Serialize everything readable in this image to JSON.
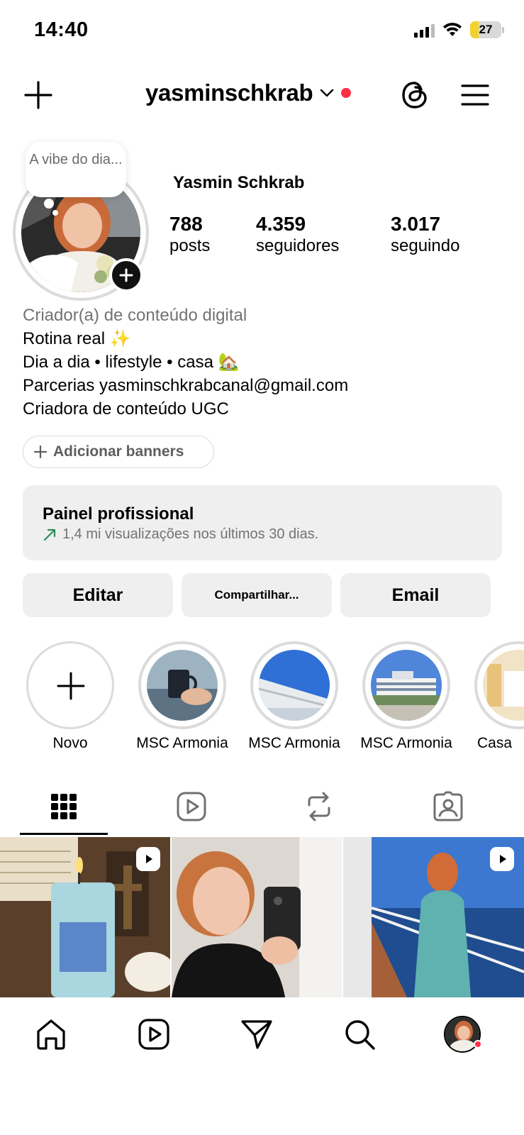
{
  "status_bar": {
    "time": "14:40",
    "battery": "27",
    "battery_level_percent": 27,
    "battery_color": "#f4d22c"
  },
  "header": {
    "username": "yasminschkrab",
    "icons": [
      "plus-icon",
      "chevron-down-icon",
      "threads-icon",
      "menu-icon"
    ],
    "notification_dot_color": "#ff2d45"
  },
  "profile": {
    "note": "A vibe do dia...",
    "display_name": "Yasmin Schkrab",
    "stats": [
      {
        "number": "788",
        "label": "posts"
      },
      {
        "number": "4.359",
        "label": "seguidores"
      },
      {
        "number": "3.017",
        "label": "seguindo"
      }
    ],
    "bio": {
      "category": "Criador(a) de conteúdo digital",
      "lines": [
        "Rotina real ✨",
        "Dia a dia • lifestyle • casa 🏡",
        "Parcerias yasminschkrabcanal@gmail.com",
        "Criadora de conteúdo UGC"
      ]
    },
    "banners_button": "Adicionar banners"
  },
  "pro_panel": {
    "title": "Painel profissional",
    "subtitle": "1,4 mi visualizações nos últimos 30 dias.",
    "trend_color": "#2e8b57"
  },
  "actions": {
    "edit": "Editar",
    "share": "Compartilhar...",
    "email": "Email"
  },
  "highlights": [
    {
      "label": "Novo"
    },
    {
      "label": "MSC Armonia"
    },
    {
      "label": "MSC Armonia"
    },
    {
      "label": "MSC Armonia"
    },
    {
      "label": "Casa"
    }
  ],
  "tabs": [
    "grid-icon",
    "reels-icon",
    "reposts-icon",
    "tagged-icon"
  ],
  "bottom_nav": [
    "home-icon",
    "reels-icon",
    "send-icon",
    "search-icon",
    "profile-avatar"
  ]
}
